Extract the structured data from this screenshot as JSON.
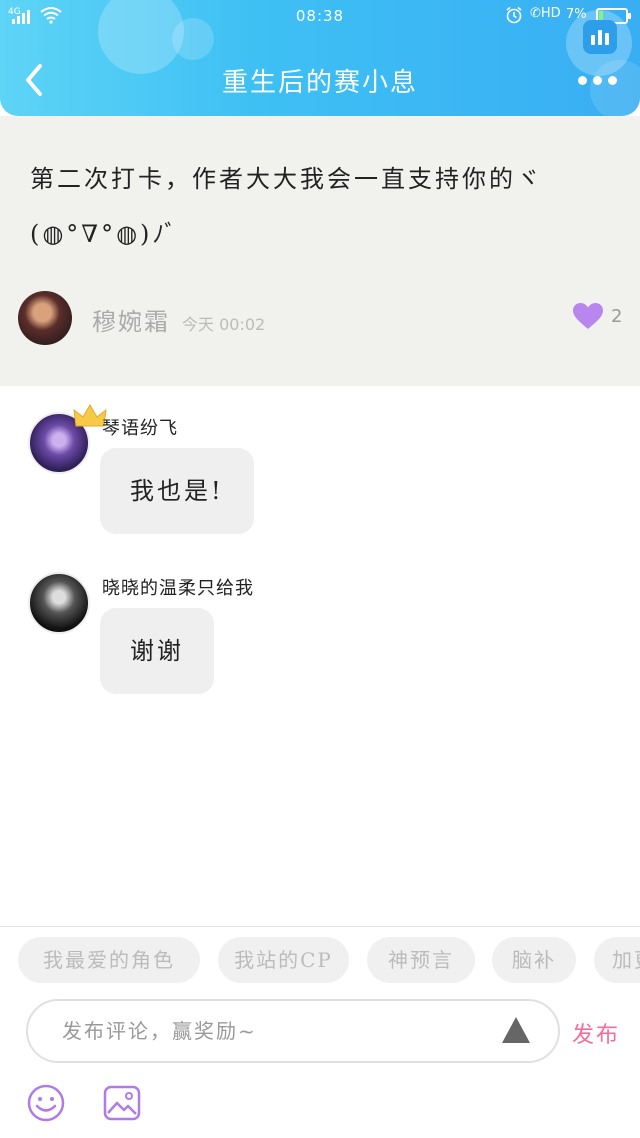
{
  "status_bar": {
    "network": "4G",
    "time": "08:38",
    "hd": "HD",
    "battery": "7%"
  },
  "header": {
    "title": "重生后的赛小息"
  },
  "post": {
    "text": "第二次打卡，作者大大我会一直支持你的ヾ(◍°∇°◍)ﾉﾞ",
    "author": "穆婉霜",
    "time": "今天 00:02",
    "likes": "2"
  },
  "comments": [
    {
      "name": "琴语纷飞",
      "text": "我也是!"
    },
    {
      "name": "晓晓的温柔只给我",
      "text": "谢谢"
    }
  ],
  "tags": [
    "我最爱的角色",
    "我站的CP",
    "神预言",
    "脑补",
    "加更"
  ],
  "composer": {
    "placeholder": "发布评论，赢奖励~",
    "publish_label": "发布"
  },
  "colors": {
    "header_start": "#5ed4f6",
    "header_end": "#39aef3",
    "like": "#b986f0",
    "publish": "#ef6f98"
  }
}
